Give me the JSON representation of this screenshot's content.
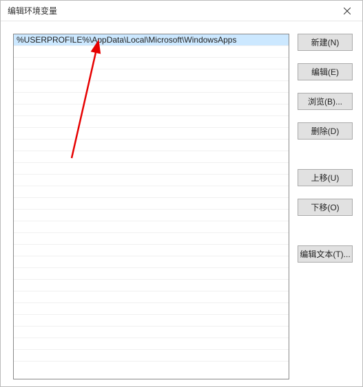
{
  "window": {
    "title": "编辑环境变量"
  },
  "list": {
    "items": [
      "%USERPROFILE%\\AppData\\Local\\Microsoft\\WindowsApps"
    ],
    "selected_index": 0,
    "empty_row_count": 27
  },
  "buttons": {
    "new": "新建(N)",
    "edit": "编辑(E)",
    "browse": "浏览(B)...",
    "delete": "删除(D)",
    "move_up": "上移(U)",
    "move_down": "下移(O)",
    "edit_text": "编辑文本(T)..."
  },
  "annotation": {
    "arrow_color": "#e60000"
  }
}
